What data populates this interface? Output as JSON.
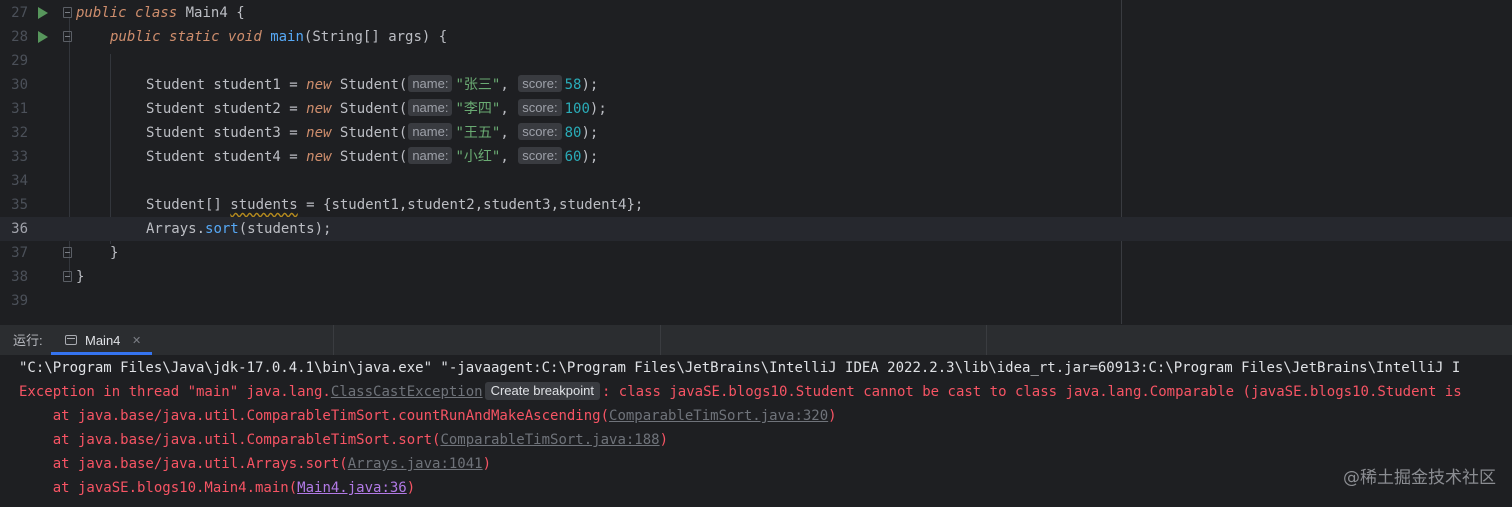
{
  "editor": {
    "lines": [
      {
        "num": "27"
      },
      {
        "num": "28"
      },
      {
        "num": "29"
      },
      {
        "num": "30"
      },
      {
        "num": "31"
      },
      {
        "num": "32"
      },
      {
        "num": "33"
      },
      {
        "num": "34"
      },
      {
        "num": "35"
      },
      {
        "num": "36"
      },
      {
        "num": "37"
      },
      {
        "num": "38"
      },
      {
        "num": "39"
      }
    ],
    "code": {
      "l27": {
        "kw1": "public",
        "kw2": "class",
        "cls": "Main4",
        "brace": " {"
      },
      "l28": {
        "kw1": "public",
        "kw2": "static",
        "kw3": "void",
        "fn": "main",
        "rest": "(String[] args) {"
      },
      "students": [
        {
          "decl": "Student student1 = ",
          "ctor": "Student(",
          "hint_name": "name:",
          "name": "\"张三\"",
          "hint_score": "score:",
          "score": "58",
          "end": ");"
        },
        {
          "decl": "Student student2 = ",
          "ctor": "Student(",
          "hint_name": "name:",
          "name": "\"李四\"",
          "hint_score": "score:",
          "score": "100",
          "end": ");"
        },
        {
          "decl": "Student student3 = ",
          "ctor": "Student(",
          "hint_name": "name:",
          "name": "\"王五\"",
          "hint_score": "score:",
          "score": "80",
          "end": ");"
        },
        {
          "decl": "Student student4 = ",
          "ctor": "Student(",
          "hint_name": "name:",
          "name": "\"小红\"",
          "hint_score": "score:",
          "score": "60",
          "end": ");"
        }
      ],
      "new_kw": "new",
      "l35": {
        "type": "Student[] ",
        "var": "students",
        "rest": " = {student1,student2,student3,student4};"
      },
      "l36": {
        "obj": "Arrays.",
        "fn": "sort",
        "rest": "(students);"
      },
      "l37": "}",
      "l38": "}"
    }
  },
  "run_panel": {
    "label": "运行:",
    "tab_label": "Main4",
    "close": "✕"
  },
  "console": {
    "cmd": "\"C:\\Program Files\\Java\\jdk-17.0.4.1\\bin\\java.exe\" \"-javaagent:C:\\Program Files\\JetBrains\\IntelliJ IDEA 2022.2.3\\lib\\idea_rt.jar=60913:C:\\Program Files\\JetBrains\\IntelliJ I",
    "exc_prefix": "Exception in thread \"main\" java.lang.",
    "exc_link": "ClassCastException",
    "breakpoint": "Create breakpoint",
    "exc_suffix": ": class javaSE.blogs10.Student cannot be cast to class java.lang.Comparable (javaSE.blogs10.Student is",
    "stack": [
      {
        "at": "    at java.base/java.util.ComparableTimSort.countRunAndMakeAscending(",
        "link": "ComparableTimSort.java:320",
        "end": ")"
      },
      {
        "at": "    at java.base/java.util.ComparableTimSort.sort(",
        "link": "ComparableTimSort.java:188",
        "end": ")"
      },
      {
        "at": "    at java.base/java.util.Arrays.sort(",
        "link": "Arrays.java:1041",
        "end": ")"
      },
      {
        "at": "    at javaSE.blogs10.Main4.main(",
        "link": "Main4.java:36",
        "end": ")"
      }
    ]
  },
  "watermark": "@稀土掘金技术社区"
}
